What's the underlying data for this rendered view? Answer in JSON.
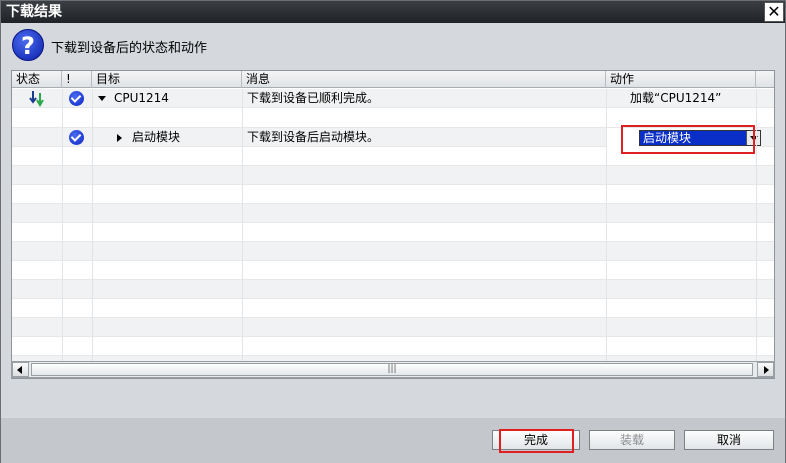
{
  "window": {
    "title": "下载结果",
    "close_symbol": "✕"
  },
  "header": {
    "icon": "question-icon",
    "icon_glyph": "?",
    "text": "下载到设备后的状态和动作"
  },
  "table": {
    "columns": [
      "状态",
      "!",
      "目标",
      "消息",
      "动作"
    ],
    "rows": [
      {
        "target": "CPU1214",
        "message": "下载到设备已顺利完成。",
        "action": "加载“CPU1214”"
      },
      {
        "target": "启动模块",
        "message": "下载到设备后启动模块。",
        "action_select": "启动模块"
      }
    ]
  },
  "scrollbar": {
    "thumb_grip": "|||"
  },
  "footer": {
    "finish_label": "完成",
    "load_label": "装载",
    "cancel_label": "取消"
  },
  "colors": {
    "accent": "#0a2ec8",
    "highlight_border": "#e02020",
    "title_bar": "#1f2226"
  }
}
